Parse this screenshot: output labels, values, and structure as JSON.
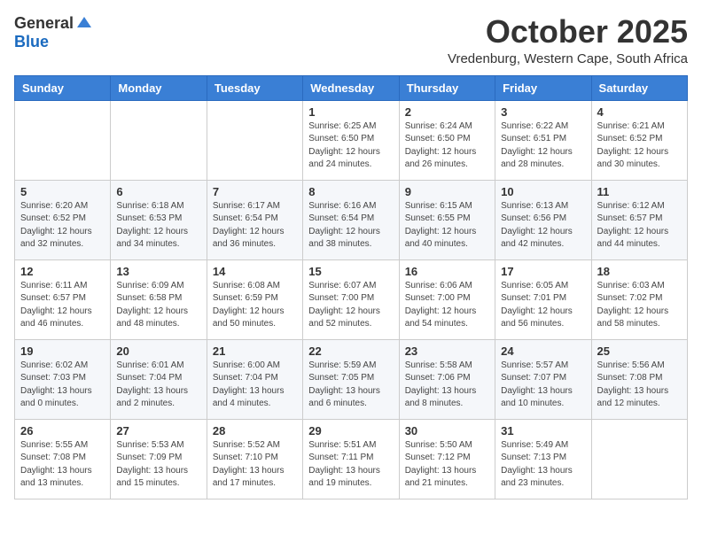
{
  "logo": {
    "general": "General",
    "blue": "Blue"
  },
  "title": "October 2025",
  "subtitle": "Vredenburg, Western Cape, South Africa",
  "weekdays": [
    "Sunday",
    "Monday",
    "Tuesday",
    "Wednesday",
    "Thursday",
    "Friday",
    "Saturday"
  ],
  "rows": [
    [
      {
        "day": "",
        "info": ""
      },
      {
        "day": "",
        "info": ""
      },
      {
        "day": "",
        "info": ""
      },
      {
        "day": "1",
        "info": "Sunrise: 6:25 AM\nSunset: 6:50 PM\nDaylight: 12 hours\nand 24 minutes."
      },
      {
        "day": "2",
        "info": "Sunrise: 6:24 AM\nSunset: 6:50 PM\nDaylight: 12 hours\nand 26 minutes."
      },
      {
        "day": "3",
        "info": "Sunrise: 6:22 AM\nSunset: 6:51 PM\nDaylight: 12 hours\nand 28 minutes."
      },
      {
        "day": "4",
        "info": "Sunrise: 6:21 AM\nSunset: 6:52 PM\nDaylight: 12 hours\nand 30 minutes."
      }
    ],
    [
      {
        "day": "5",
        "info": "Sunrise: 6:20 AM\nSunset: 6:52 PM\nDaylight: 12 hours\nand 32 minutes."
      },
      {
        "day": "6",
        "info": "Sunrise: 6:18 AM\nSunset: 6:53 PM\nDaylight: 12 hours\nand 34 minutes."
      },
      {
        "day": "7",
        "info": "Sunrise: 6:17 AM\nSunset: 6:54 PM\nDaylight: 12 hours\nand 36 minutes."
      },
      {
        "day": "8",
        "info": "Sunrise: 6:16 AM\nSunset: 6:54 PM\nDaylight: 12 hours\nand 38 minutes."
      },
      {
        "day": "9",
        "info": "Sunrise: 6:15 AM\nSunset: 6:55 PM\nDaylight: 12 hours\nand 40 minutes."
      },
      {
        "day": "10",
        "info": "Sunrise: 6:13 AM\nSunset: 6:56 PM\nDaylight: 12 hours\nand 42 minutes."
      },
      {
        "day": "11",
        "info": "Sunrise: 6:12 AM\nSunset: 6:57 PM\nDaylight: 12 hours\nand 44 minutes."
      }
    ],
    [
      {
        "day": "12",
        "info": "Sunrise: 6:11 AM\nSunset: 6:57 PM\nDaylight: 12 hours\nand 46 minutes."
      },
      {
        "day": "13",
        "info": "Sunrise: 6:09 AM\nSunset: 6:58 PM\nDaylight: 12 hours\nand 48 minutes."
      },
      {
        "day": "14",
        "info": "Sunrise: 6:08 AM\nSunset: 6:59 PM\nDaylight: 12 hours\nand 50 minutes."
      },
      {
        "day": "15",
        "info": "Sunrise: 6:07 AM\nSunset: 7:00 PM\nDaylight: 12 hours\nand 52 minutes."
      },
      {
        "day": "16",
        "info": "Sunrise: 6:06 AM\nSunset: 7:00 PM\nDaylight: 12 hours\nand 54 minutes."
      },
      {
        "day": "17",
        "info": "Sunrise: 6:05 AM\nSunset: 7:01 PM\nDaylight: 12 hours\nand 56 minutes."
      },
      {
        "day": "18",
        "info": "Sunrise: 6:03 AM\nSunset: 7:02 PM\nDaylight: 12 hours\nand 58 minutes."
      }
    ],
    [
      {
        "day": "19",
        "info": "Sunrise: 6:02 AM\nSunset: 7:03 PM\nDaylight: 13 hours\nand 0 minutes."
      },
      {
        "day": "20",
        "info": "Sunrise: 6:01 AM\nSunset: 7:04 PM\nDaylight: 13 hours\nand 2 minutes."
      },
      {
        "day": "21",
        "info": "Sunrise: 6:00 AM\nSunset: 7:04 PM\nDaylight: 13 hours\nand 4 minutes."
      },
      {
        "day": "22",
        "info": "Sunrise: 5:59 AM\nSunset: 7:05 PM\nDaylight: 13 hours\nand 6 minutes."
      },
      {
        "day": "23",
        "info": "Sunrise: 5:58 AM\nSunset: 7:06 PM\nDaylight: 13 hours\nand 8 minutes."
      },
      {
        "day": "24",
        "info": "Sunrise: 5:57 AM\nSunset: 7:07 PM\nDaylight: 13 hours\nand 10 minutes."
      },
      {
        "day": "25",
        "info": "Sunrise: 5:56 AM\nSunset: 7:08 PM\nDaylight: 13 hours\nand 12 minutes."
      }
    ],
    [
      {
        "day": "26",
        "info": "Sunrise: 5:55 AM\nSunset: 7:08 PM\nDaylight: 13 hours\nand 13 minutes."
      },
      {
        "day": "27",
        "info": "Sunrise: 5:53 AM\nSunset: 7:09 PM\nDaylight: 13 hours\nand 15 minutes."
      },
      {
        "day": "28",
        "info": "Sunrise: 5:52 AM\nSunset: 7:10 PM\nDaylight: 13 hours\nand 17 minutes."
      },
      {
        "day": "29",
        "info": "Sunrise: 5:51 AM\nSunset: 7:11 PM\nDaylight: 13 hours\nand 19 minutes."
      },
      {
        "day": "30",
        "info": "Sunrise: 5:50 AM\nSunset: 7:12 PM\nDaylight: 13 hours\nand 21 minutes."
      },
      {
        "day": "31",
        "info": "Sunrise: 5:49 AM\nSunset: 7:13 PM\nDaylight: 13 hours\nand 23 minutes."
      },
      {
        "day": "",
        "info": ""
      }
    ]
  ]
}
